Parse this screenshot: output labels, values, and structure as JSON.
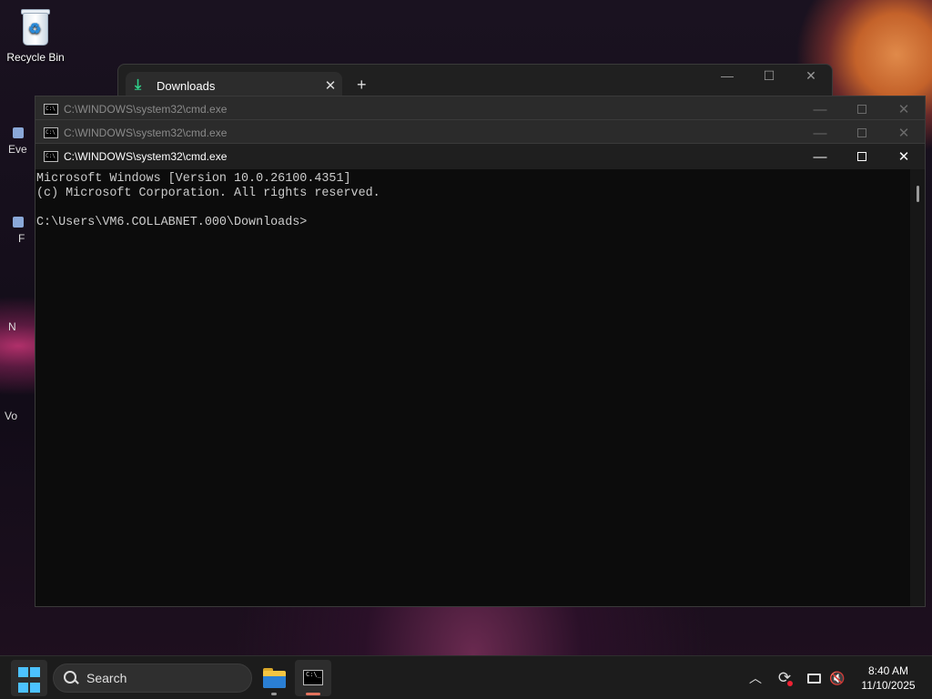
{
  "desktop": {
    "recycle_bin_label": "Recycle Bin",
    "side_fragments": [
      "Eve",
      "F",
      "N",
      "Vo"
    ]
  },
  "explorer": {
    "tab_label": "Downloads",
    "tab_close": "✕",
    "new_tab": "+",
    "minimize": "—",
    "maximize": "☐",
    "close": "✕"
  },
  "cmd_windows": [
    {
      "title": "C:\\WINDOWS\\system32\\cmd.exe"
    },
    {
      "title": "C:\\WINDOWS\\system32\\cmd.exe"
    },
    {
      "title": "C:\\WINDOWS\\system32\\cmd.exe"
    }
  ],
  "cmd_controls": {
    "minimize": "—",
    "close": "✕"
  },
  "console": {
    "lines": [
      "Microsoft Windows [Version 10.0.26100.4351]",
      "(c) Microsoft Corporation. All rights reserved.",
      "",
      "C:\\Users\\VM6.COLLABNET.000\\Downloads>"
    ]
  },
  "taskbar": {
    "search_label": "Search",
    "tray_chevron": "︿",
    "clock_time": "8:40 AM",
    "clock_date": "11/10/2025"
  },
  "colors": {
    "accent_start": "#4cc2ff",
    "cmd_active_indicator": "#e3735e",
    "download_icon": "#2ed18a"
  }
}
